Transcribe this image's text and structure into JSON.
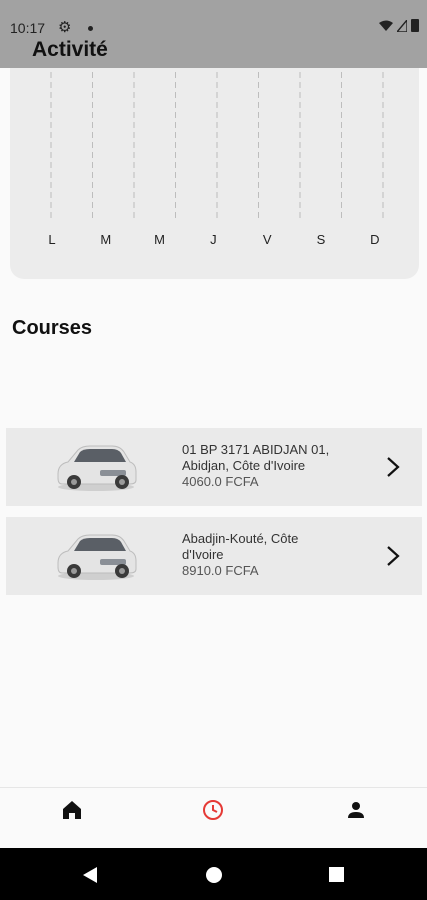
{
  "status_bar": {
    "time": "10:17"
  },
  "activity": {
    "title": "Activité",
    "days": [
      "L",
      "M",
      "M",
      "J",
      "V",
      "S",
      "D"
    ]
  },
  "courses": {
    "title": "Courses",
    "items": [
      {
        "address_line1": "01 BP 3171 ABIDJAN 01,",
        "address_line2": "Abidjan, Côte d'Ivoire",
        "price": "4060.0 FCFA"
      },
      {
        "address_line1": "Abadjin-Kouté, Côte",
        "address_line2": "d'Ivoire",
        "price": "8910.0 FCFA"
      }
    ]
  },
  "nav": {
    "active_color": "#e53935",
    "items": [
      "home-icon",
      "clock-icon",
      "person-icon"
    ]
  },
  "system_nav": [
    "back-icon",
    "home-circle-icon",
    "recents-icon"
  ]
}
